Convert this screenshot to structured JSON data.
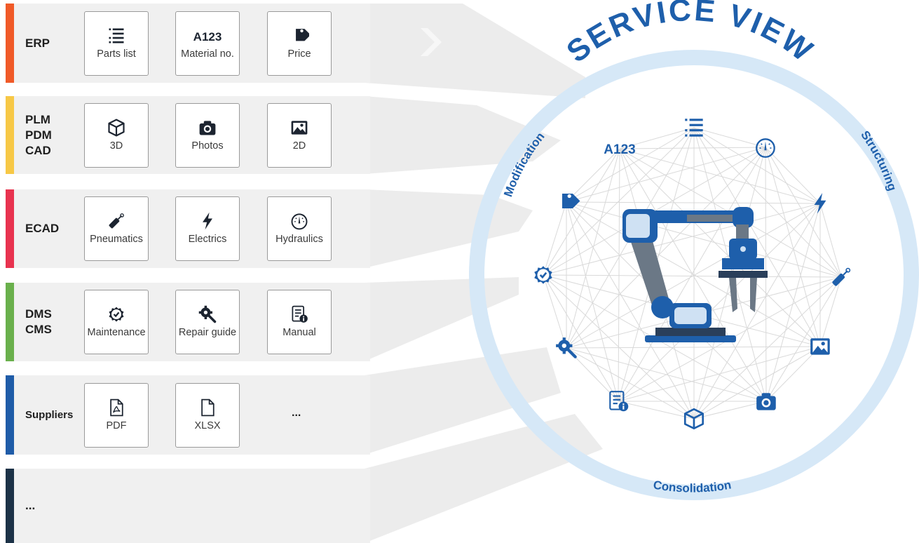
{
  "title": "SERVICE VIEW",
  "ring_labels": {
    "left": "Modification",
    "right": "Structuring",
    "bottom": "Consolidation"
  },
  "colors": {
    "erp": "#f05a28",
    "plm": "#f7c846",
    "ecad": "#e8334f",
    "dms": "#6ab04c",
    "suppliers": "#1f5ca8",
    "other": "#1c3247",
    "accent_blue": "#1e5fab",
    "ring": "#d6e8f7"
  },
  "sources": [
    {
      "label_lines": [
        "ERP"
      ],
      "tiles": [
        {
          "icon": "list-icon",
          "label": "Parts list"
        },
        {
          "icon": "material-number-icon",
          "icon_text": "A123",
          "label": "Material no."
        },
        {
          "icon": "price-tag-icon",
          "label": "Price"
        }
      ]
    },
    {
      "label_lines": [
        "PLM",
        "PDM",
        "CAD"
      ],
      "tiles": [
        {
          "icon": "cube-icon",
          "label": "3D"
        },
        {
          "icon": "camera-icon",
          "label": "Photos"
        },
        {
          "icon": "image-icon",
          "label": "2D"
        }
      ]
    },
    {
      "label_lines": [
        "ECAD"
      ],
      "tiles": [
        {
          "icon": "pneumatic-cylinder-icon",
          "label": "Pneumatics"
        },
        {
          "icon": "lightning-icon",
          "label": "Electrics"
        },
        {
          "icon": "gauge-icon",
          "label": "Hydraulics"
        }
      ]
    },
    {
      "label_lines": [
        "DMS",
        "CMS"
      ],
      "tiles": [
        {
          "icon": "maintenance-badge-icon",
          "label": "Maintenance"
        },
        {
          "icon": "repair-gear-wrench-icon",
          "label": "Repair guide"
        },
        {
          "icon": "manual-book-icon",
          "label": "Manual"
        }
      ]
    },
    {
      "label_lines": [
        "Suppliers"
      ],
      "tiles": [
        {
          "icon": "pdf-file-icon",
          "label": "PDF"
        },
        {
          "icon": "xlsx-file-icon",
          "label": "XLSX"
        }
      ],
      "more": "..."
    },
    {
      "label_lines": [
        "..."
      ],
      "tiles": []
    }
  ],
  "center_icons": [
    {
      "icon": "material-number-icon",
      "text": "A123"
    },
    {
      "icon": "list-icon"
    },
    {
      "icon": "gauge-icon"
    },
    {
      "icon": "lightning-icon"
    },
    {
      "icon": "pneumatic-cylinder-icon"
    },
    {
      "icon": "image-icon"
    },
    {
      "icon": "camera-icon"
    },
    {
      "icon": "cube-icon"
    },
    {
      "icon": "manual-book-icon"
    },
    {
      "icon": "repair-gear-wrench-icon"
    },
    {
      "icon": "maintenance-badge-icon"
    },
    {
      "icon": "price-tag-icon"
    }
  ],
  "center_image": "industrial-robot-arm"
}
